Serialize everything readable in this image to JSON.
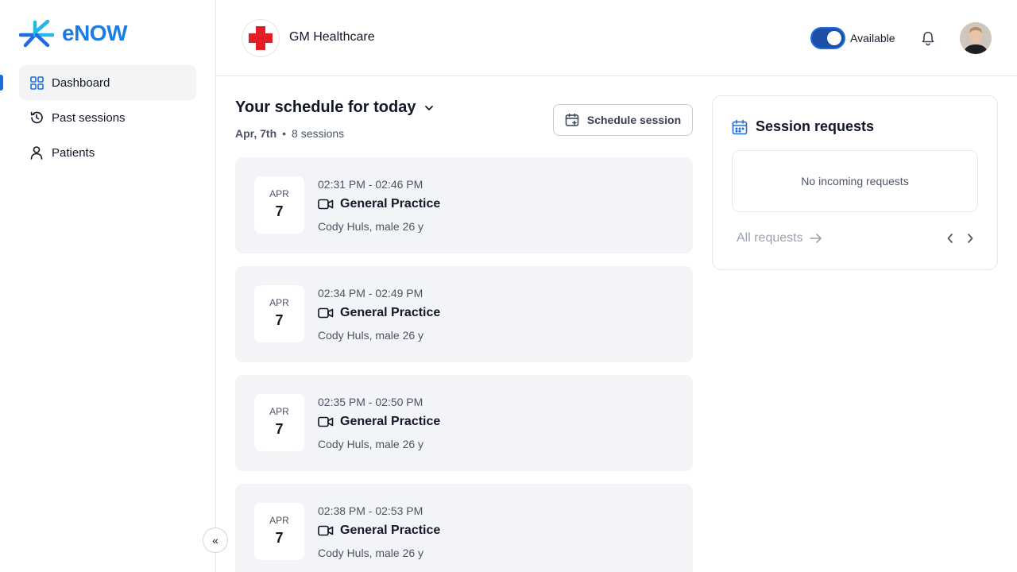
{
  "app": {
    "name": "eNOW"
  },
  "sidebar": {
    "items": [
      {
        "label": "Dashboard",
        "icon": "grid-icon",
        "active": true
      },
      {
        "label": "Past sessions",
        "icon": "history-icon"
      },
      {
        "label": "Patients",
        "icon": "user-icon"
      }
    ],
    "collapse_icon": "«"
  },
  "header": {
    "org_name": "GM Healthcare",
    "availability_label": "Available",
    "available": true
  },
  "schedule": {
    "title": "Your schedule for today",
    "date": "Apr, 7th",
    "separator": "•",
    "count": "8 sessions",
    "button_label": "Schedule session",
    "sessions": [
      {
        "month": "APR",
        "day": "7",
        "time": "02:31 PM - 02:46 PM",
        "type": "General Practice",
        "patient": "Cody Huls, male 26 y"
      },
      {
        "month": "APR",
        "day": "7",
        "time": "02:34 PM - 02:49 PM",
        "type": "General Practice",
        "patient": "Cody Huls, male 26 y"
      },
      {
        "month": "APR",
        "day": "7",
        "time": "02:35 PM - 02:50 PM",
        "type": "General Practice",
        "patient": "Cody Huls, male 26 y"
      },
      {
        "month": "APR",
        "day": "7",
        "time": "02:38 PM - 02:53 PM",
        "type": "General Practice",
        "patient": "Cody Huls, male 26 y"
      }
    ]
  },
  "requests": {
    "title": "Session requests",
    "empty_text": "No incoming requests",
    "all_label": "All requests"
  },
  "colors": {
    "brand": "#1d7be6",
    "accent": "#1d6ce0",
    "card_bg": "#f3f4f8",
    "cross_red": "#e41e26"
  }
}
